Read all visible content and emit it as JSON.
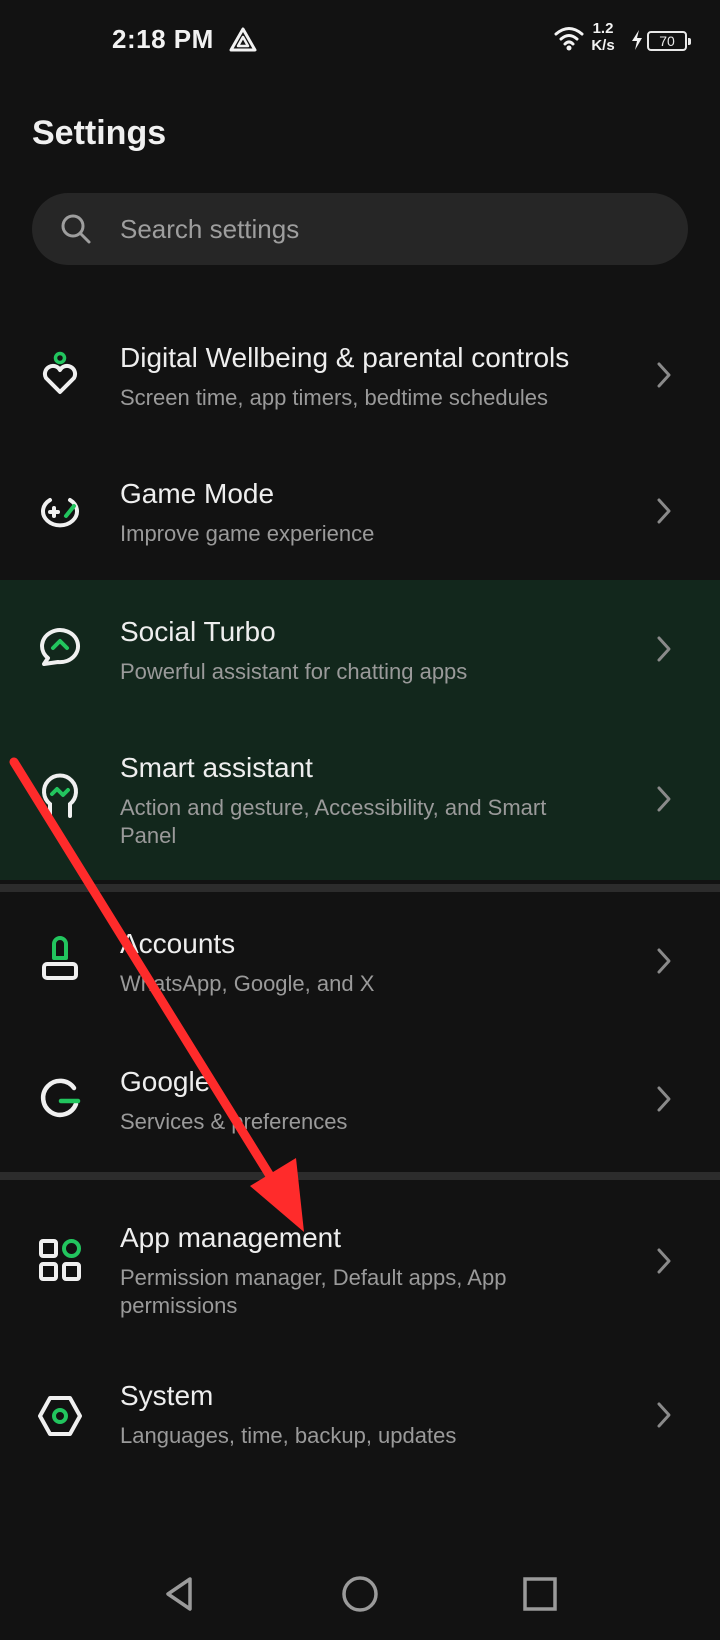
{
  "status_bar": {
    "time": "2:18 PM",
    "net_speed_value": "1.2",
    "net_speed_unit": "K/s",
    "battery_level": "70"
  },
  "header": {
    "title": "Settings"
  },
  "search": {
    "placeholder": "Search settings"
  },
  "items": [
    {
      "title": "Digital Wellbeing & parental controls",
      "subtitle": "Screen time, app timers, bedtime schedules",
      "icon": "digital-wellbeing-icon"
    },
    {
      "title": "Game Mode",
      "subtitle": "Improve game experience",
      "icon": "game-mode-icon"
    },
    {
      "title": "Social Turbo",
      "subtitle": "Powerful assistant for chatting apps",
      "icon": "social-turbo-icon"
    },
    {
      "title": "Smart assistant",
      "subtitle": "Action and gesture, Accessibility, and Smart Panel",
      "icon": "smart-assistant-icon"
    },
    {
      "title": "Accounts",
      "subtitle": "WhatsApp, Google, and X",
      "icon": "accounts-icon"
    },
    {
      "title": "Google",
      "subtitle": "Services & preferences",
      "icon": "google-icon"
    },
    {
      "title": "App management",
      "subtitle": "Permission manager, Default apps, App permissions",
      "icon": "app-management-icon"
    },
    {
      "title": "System",
      "subtitle": "Languages, time, backup, updates",
      "icon": "system-icon"
    }
  ],
  "colors": {
    "background": "#121212",
    "accent": "#22c55e",
    "highlight_row": "#12271c",
    "annotation_arrow": "#ff2b2b"
  },
  "nav_bar": {
    "icons": [
      "back-icon",
      "home-icon",
      "recents-icon"
    ]
  }
}
